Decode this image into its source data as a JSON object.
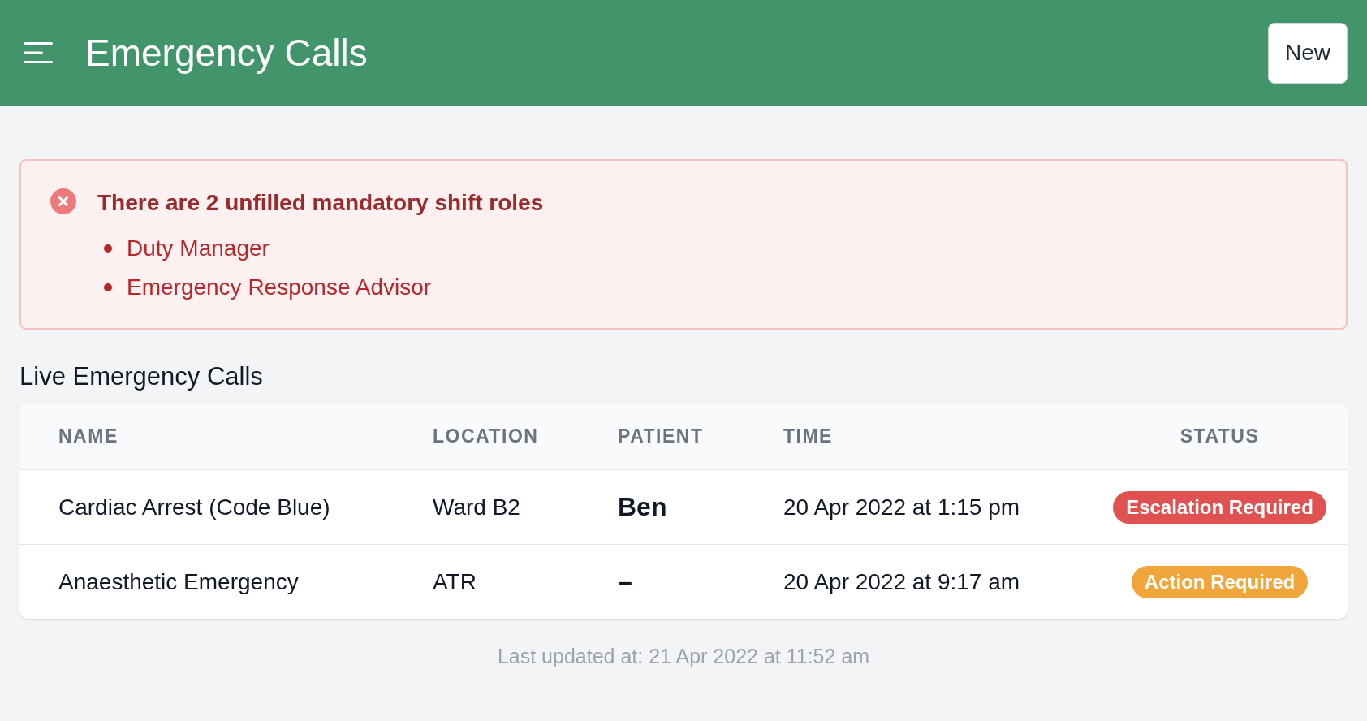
{
  "header": {
    "title": "Emergency Calls",
    "new_button": "New"
  },
  "alert": {
    "title": "There are 2 unfilled mandatory shift roles",
    "items": [
      "Duty Manager",
      "Emergency Response Advisor"
    ]
  },
  "section_title": "Live Emergency Calls",
  "table": {
    "columns": [
      "NAME",
      "LOCATION",
      "PATIENT",
      "TIME",
      "STATUS"
    ],
    "rows": [
      {
        "name": "Cardiac Arrest (Code Blue)",
        "location": "Ward B2",
        "patient": "Ben",
        "time": "20 Apr 2022 at 1:15 pm",
        "status": "Escalation Required",
        "color": "#e05252"
      },
      {
        "name": "Anaesthetic Emergency",
        "location": "ATR",
        "patient": "–",
        "time": "20 Apr 2022 at 9:17 am",
        "status": "Action Required",
        "color": "#f0a63a"
      }
    ]
  },
  "footer": "Last updated at: 21 Apr 2022 at 11:52 am"
}
